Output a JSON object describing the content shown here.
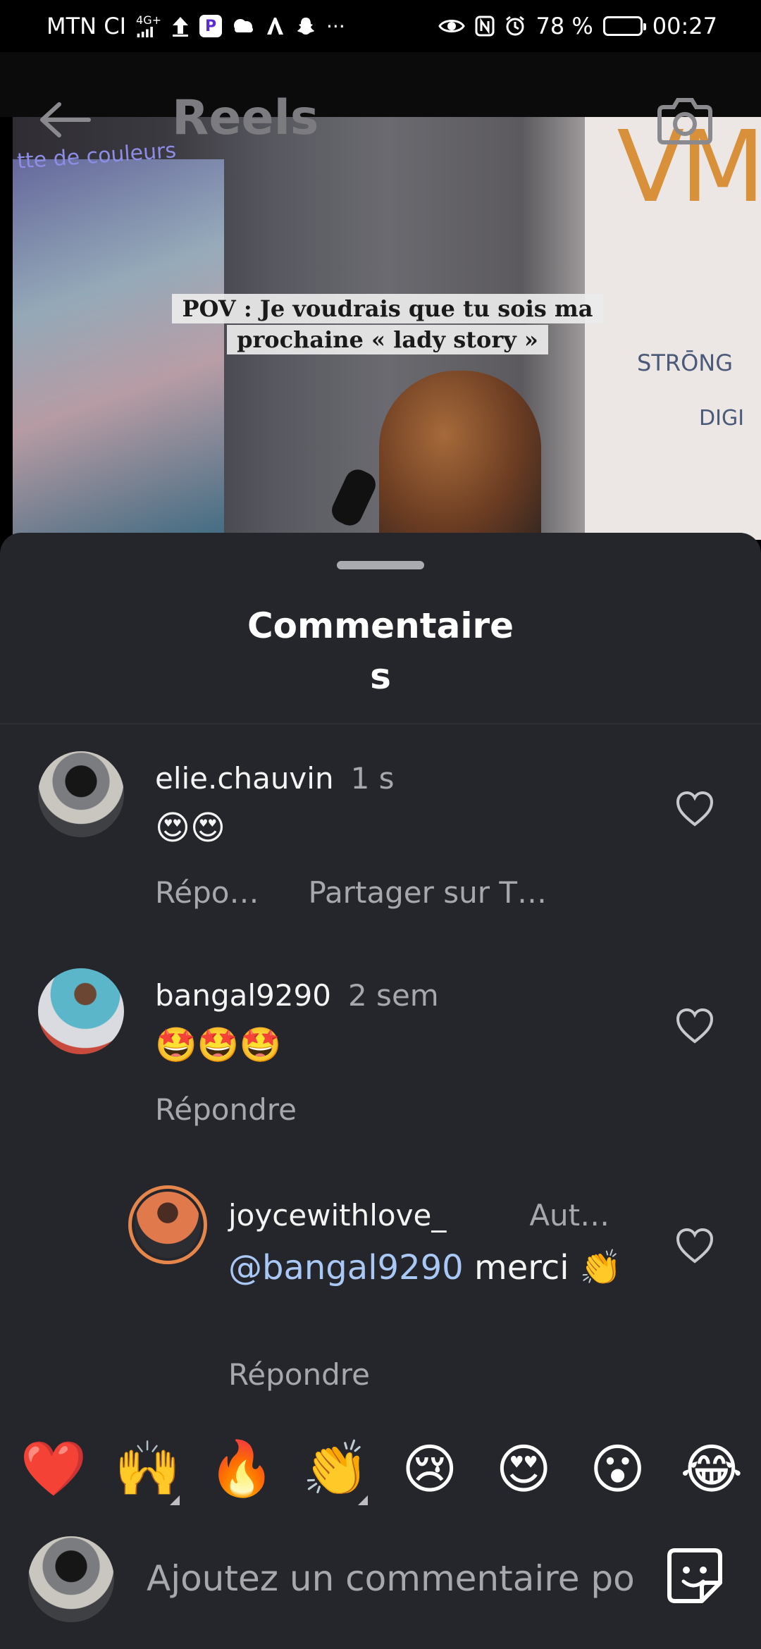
{
  "status_bar": {
    "carrier": "MTN CI",
    "network": "4G+",
    "battery": "78 %",
    "battery_level": 0.78,
    "time": "00:27"
  },
  "header": {
    "title": "Reels",
    "back_icon": "arrow-left-icon",
    "camera_icon": "camera-icon"
  },
  "reel": {
    "caption_line1": "POV : Je voudrais que tu sois ma",
    "caption_line2": "prochaine « lady story »",
    "background_text_left": "tte de couleurs",
    "background_text_right": "VM",
    "sponsors": [
      "STRŌNG",
      "DIGI"
    ]
  },
  "sheet": {
    "title": "Commentaires"
  },
  "comments": [
    {
      "username": "elie.chauvin",
      "time": "1 s",
      "text": "😍😍",
      "actions": [
        "Répo…",
        "Partager sur T…"
      ]
    },
    {
      "username": "bangal9290",
      "time": "2 sem",
      "text": "🤩🤩🤩",
      "actions": [
        "Répondre"
      ]
    },
    {
      "username": "joycewithlove_",
      "time": "Aut…",
      "mention": "@bangal9290",
      "text": " merci 👏",
      "actions": [
        "Répondre"
      ]
    }
  ],
  "emoji_bar": [
    "❤️",
    "🙌",
    "🔥",
    "👏",
    "😢",
    "😍",
    "😮",
    "😂"
  ],
  "input": {
    "placeholder": "Ajoutez un commentaire po"
  },
  "colors": {
    "sheet_bg": "#25262b",
    "secondary_text": "#a6a8ae",
    "mention": "#a9c8f5"
  }
}
